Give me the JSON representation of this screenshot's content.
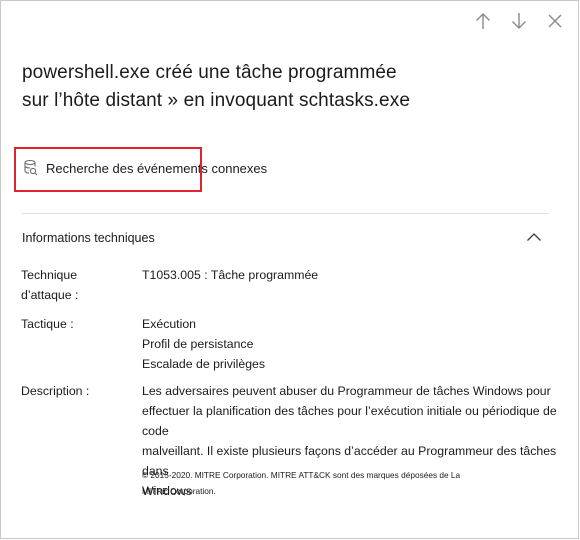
{
  "nav": {
    "up_icon": "arrow-up-icon",
    "down_icon": "arrow-down-icon",
    "close_icon": "close-icon"
  },
  "title": {
    "line1": "powershell.exe créé une tâche programmée",
    "line2": "sur l’hôte distant » en invoquant schtasks.exe"
  },
  "related_events": {
    "icon": "database-search-icon",
    "label": "Recherche des événements connexes",
    "highlight_color": "#e0232e"
  },
  "technical_info": {
    "header": "Informations techniques",
    "chevron_icon": "chevron-up-icon",
    "technique_label_line1": "Technique",
    "technique_label_line2": "d’attaque :",
    "technique_value": "T1053.005 : Tâche programmée",
    "tactic_label": "Tactique :",
    "tactics": [
      "Exécution",
      "Profil de persistance",
      "Escalade de privilèges"
    ],
    "description_label": "Description :",
    "description_lines": [
      "Les adversaires peuvent abuser du Programmeur de tâches Windows pour",
      "effectuer la planification des tâches pour l’exécution initiale ou périodique de code",
      "malveillant. Il existe plusieurs façons d’accéder au Programmeur des tâches dans",
      "Windows"
    ],
    "copyright_line1": "© 2015-2020. MITRE Corporation. MITRE ATT&CK sont des marques déposées de La",
    "copyright_line2": "MITRE Corporation."
  }
}
